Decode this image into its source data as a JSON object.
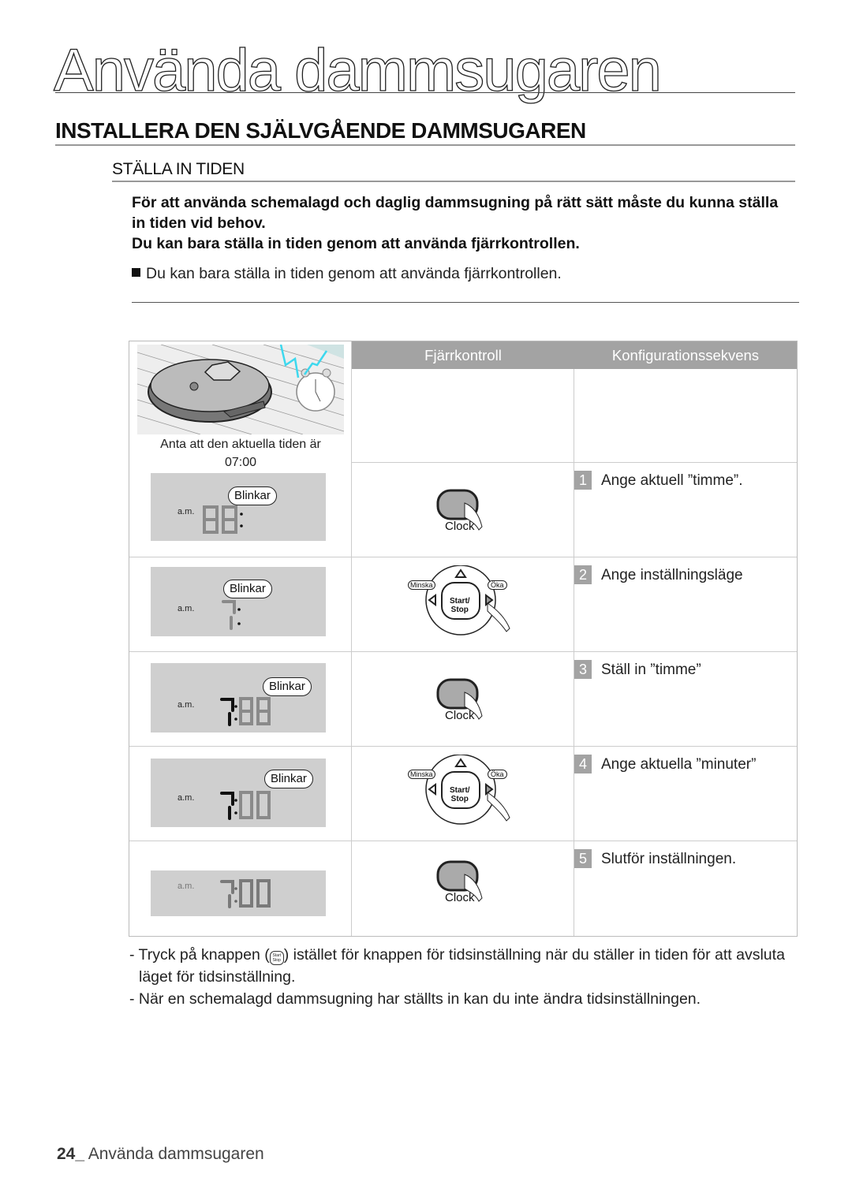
{
  "chapter_title": "Använda dammsugaren",
  "section_title": "INSTALLERA DEN SJÄLVGÅENDE DAMMSUGAREN",
  "subsection_title": "STÄLLA IN TIDEN",
  "intro": {
    "line1": "För att använda schemalagd och daglig dammsugning på rätt sätt måste du kunna ställa in tiden vid behov.",
    "line2": "Du kan bara ställa in tiden genom att använda fjärrkontrollen."
  },
  "note": "Du kan bara ställa in tiden genom att använda fjärrkontrollen.",
  "table": {
    "headers": {
      "remote": "Fjärrkontroll",
      "sequence": "Konfigurationssekvens"
    },
    "scene_caption": {
      "line1": "Anta att den aktuella tiden är",
      "line2": "07:00"
    },
    "blink_label": "Blinkar",
    "am_label": "a.m.",
    "steps": [
      {
        "num": "1",
        "text": "Ange aktuell ”timme”.",
        "display": "88",
        "button": "Clock"
      },
      {
        "num": "2",
        "text": "Ange inställningsläge",
        "display": "7",
        "button": "Öka"
      },
      {
        "num": "3",
        "text": "Ställ in ”timme”",
        "display": "7:88",
        "button": "Clock"
      },
      {
        "num": "4",
        "text": "Ange aktuella ”minuter”",
        "display": "7:00",
        "button": "Öka"
      },
      {
        "num": "5",
        "text": "Slutför inställningen.",
        "display": "7:00",
        "button": "Clock"
      }
    ],
    "remote_labels": {
      "clock": "Clock",
      "decrease": "Minska",
      "increase": "Öka",
      "start": "Start/",
      "stop": "Stop"
    }
  },
  "footnotes": {
    "fn1_pre": "- Tryck på knappen (",
    "fn1_post": ") istället för knappen för tidsinställning när du ställer in tiden för att avsluta läget för tidsinställning.",
    "fn1_btn_top": "Start",
    "fn1_btn_bot": "Stop",
    "fn2": "- När en schemalagd dammsugning har ställts in kan du inte ändra tidsinställningen."
  },
  "footer": {
    "page": "24_",
    "title": "Använda dammsugaren"
  }
}
